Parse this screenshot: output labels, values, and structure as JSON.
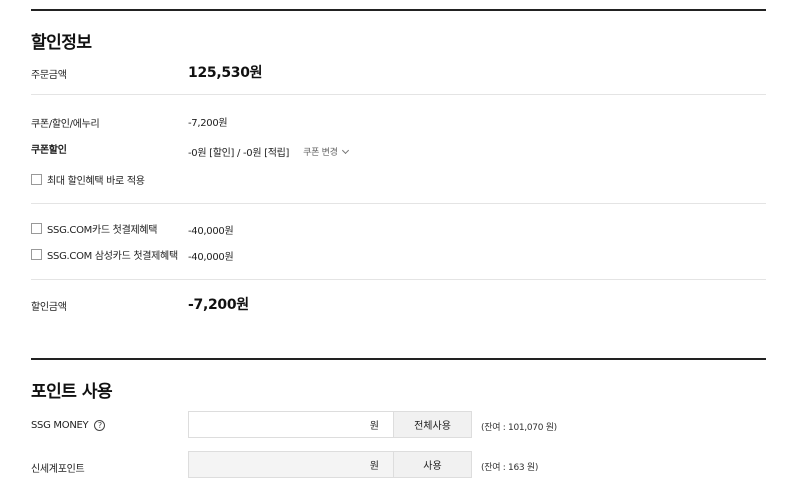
{
  "discount": {
    "title": "할인정보",
    "order_amount_label": "주문금액",
    "order_amount_value": "125,530원",
    "coupon_label": "쿠폰/할인/에누리",
    "coupon_value": "-7,200원",
    "coupon_discount_label": "쿠폰할인",
    "coupon_discount_value": "-0원 [할인] / -0원 [적립]",
    "coupon_change_label": "쿠폰 변경",
    "max_benefit_label": "최대 할인혜택 바로 적용",
    "card_offers": [
      {
        "label": "SSG.COM카드 첫결제혜택",
        "value": "-40,000원"
      },
      {
        "label": "SSG.COM 삼성카드 첫결제혜택",
        "value": "-40,000원"
      }
    ],
    "discount_amount_label": "할인금액",
    "discount_amount_value": "-7,200원"
  },
  "points": {
    "title": "포인트 사용",
    "ssg_money_label": "SSG MONEY",
    "ssg_money_unit": "원",
    "ssg_money_button": "전체사용",
    "ssg_money_balance": "(잔여 : 101,070 원)",
    "shinsegae_label": "신세계포인트",
    "shinsegae_unit": "원",
    "shinsegae_button": "사용",
    "shinsegae_balance": "(잔여 : 163 원)"
  },
  "icons": {
    "help": "question-circle-icon",
    "chevron": "chevron-down-icon",
    "checkbox": "checkbox-icon"
  },
  "colors": {
    "text": "#222222",
    "rule": "#222222",
    "divider": "#e4e4e4",
    "button_bg": "#f1f1f1"
  }
}
